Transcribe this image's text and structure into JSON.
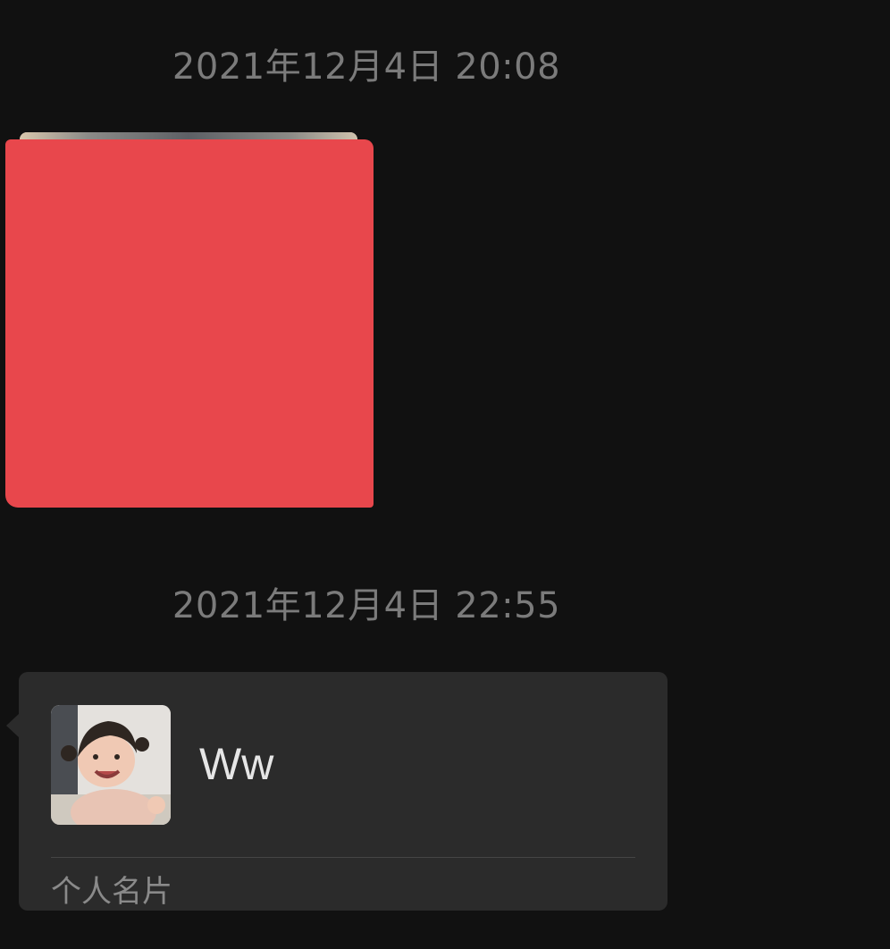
{
  "messages": {
    "timestamp_1": "2021年12月4日 20:08",
    "timestamp_2": "2021年12月4日 22:55"
  },
  "contact_card": {
    "name": "Ww",
    "label": "个人名片",
    "avatar": "child-photo"
  },
  "colors": {
    "background": "#111111",
    "bubble": "#2b2b2b",
    "redaction": "#e8474c",
    "timestamp_text": "#7b7b7b"
  }
}
